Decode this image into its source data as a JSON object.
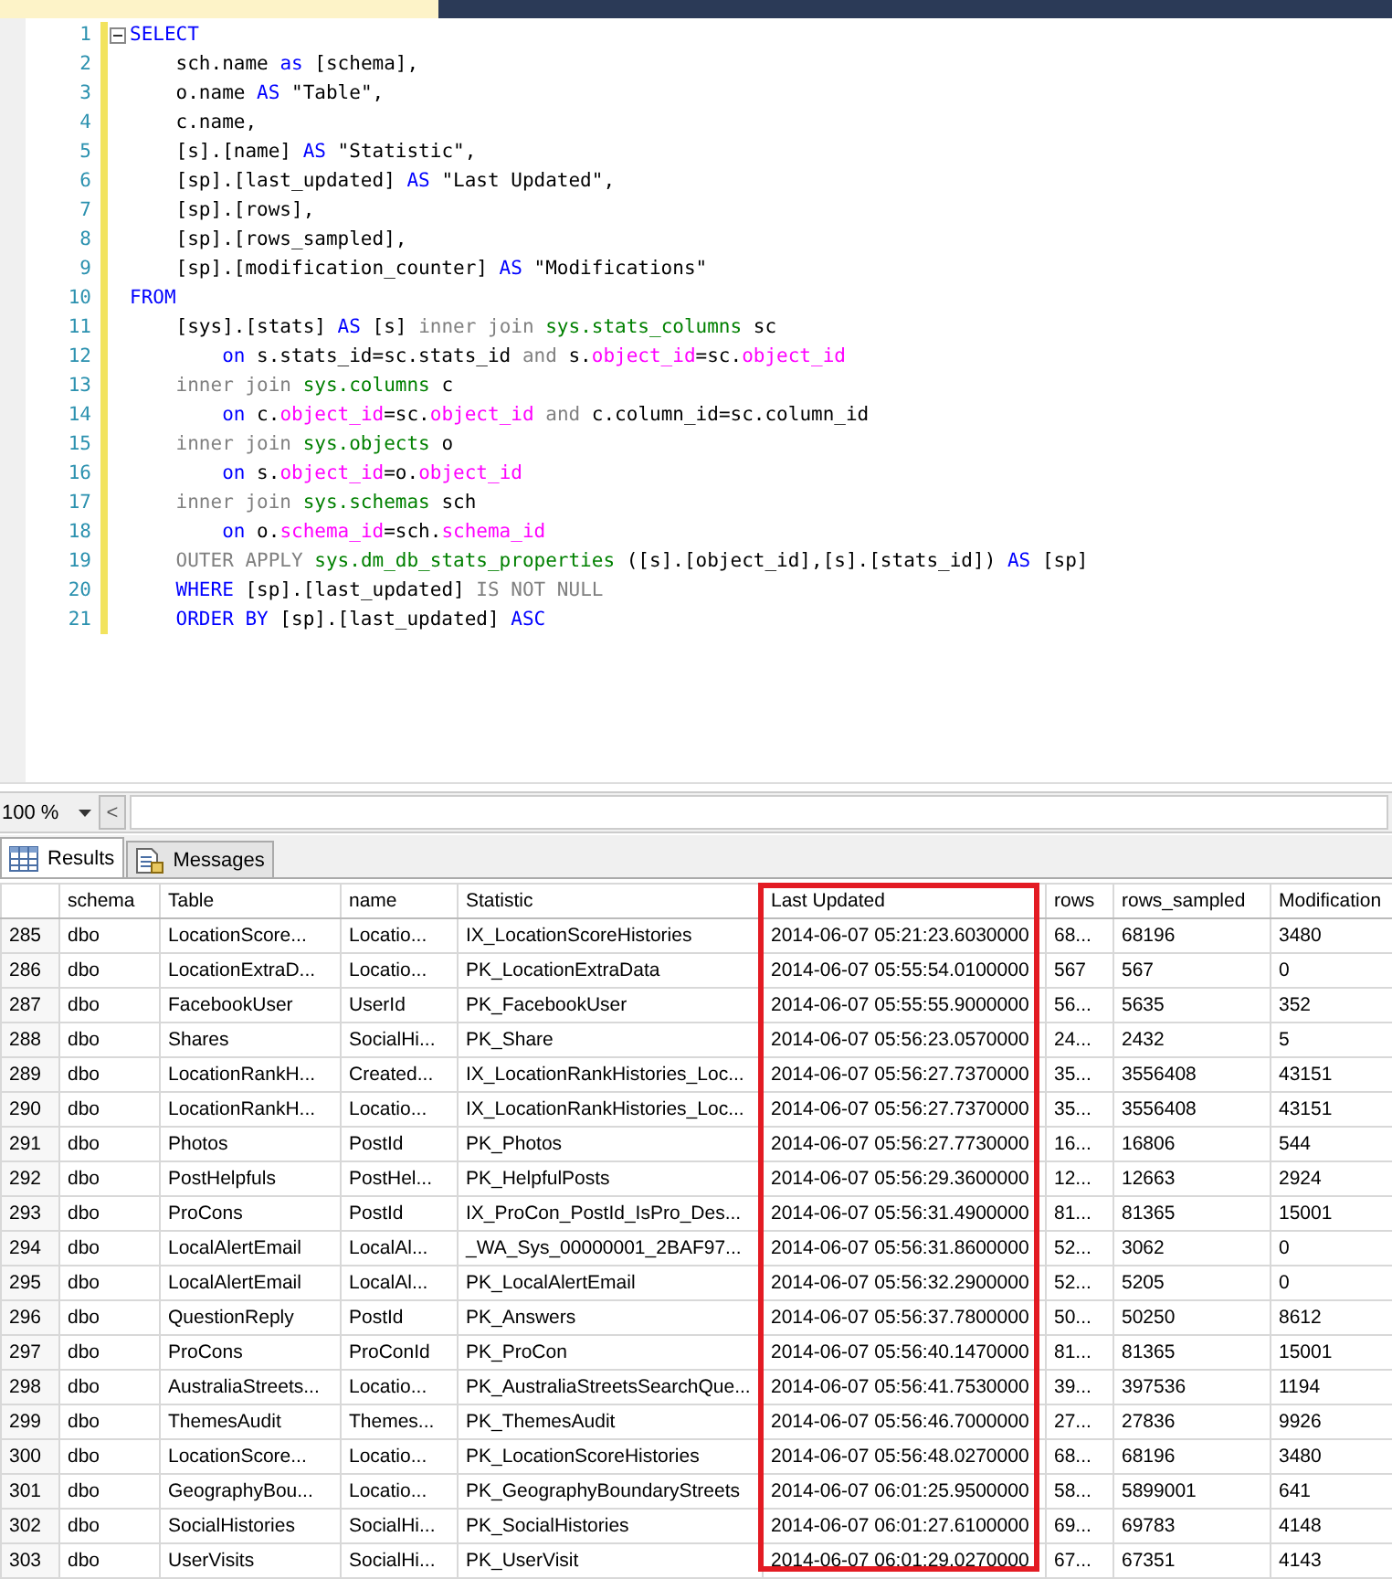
{
  "editor": {
    "lines": [
      {
        "number": "1",
        "tokens": [
          {
            "kind": "kw",
            "text": "SELECT"
          }
        ]
      },
      {
        "number": "2",
        "tokens": [
          {
            "kind": "plain",
            "text": "    sch.name "
          },
          {
            "kind": "kw",
            "text": "as"
          },
          {
            "kind": "plain",
            "text": " [schema],"
          }
        ]
      },
      {
        "number": "3",
        "tokens": [
          {
            "kind": "plain",
            "text": "    o.name "
          },
          {
            "kind": "kw",
            "text": "AS"
          },
          {
            "kind": "plain",
            "text": " \"Table\","
          }
        ]
      },
      {
        "number": "4",
        "tokens": [
          {
            "kind": "plain",
            "text": "    c.name,"
          }
        ]
      },
      {
        "number": "5",
        "tokens": [
          {
            "kind": "plain",
            "text": "    [s].[name] "
          },
          {
            "kind": "kw",
            "text": "AS"
          },
          {
            "kind": "plain",
            "text": " \"Statistic\","
          }
        ]
      },
      {
        "number": "6",
        "tokens": [
          {
            "kind": "plain",
            "text": "    [sp].[last_updated] "
          },
          {
            "kind": "kw",
            "text": "AS"
          },
          {
            "kind": "plain",
            "text": " \"Last Updated\","
          }
        ]
      },
      {
        "number": "7",
        "tokens": [
          {
            "kind": "plain",
            "text": "    [sp].[rows],"
          }
        ]
      },
      {
        "number": "8",
        "tokens": [
          {
            "kind": "plain",
            "text": "    [sp].[rows_sampled],"
          }
        ]
      },
      {
        "number": "9",
        "tokens": [
          {
            "kind": "plain",
            "text": "    [sp].[modification_counter] "
          },
          {
            "kind": "kw",
            "text": "AS"
          },
          {
            "kind": "plain",
            "text": " \"Modifications\""
          }
        ]
      },
      {
        "number": "10",
        "tokens": [
          {
            "kind": "kw",
            "text": "FROM"
          }
        ]
      },
      {
        "number": "11",
        "tokens": [
          {
            "kind": "plain",
            "text": "    [sys].[stats] "
          },
          {
            "kind": "kw",
            "text": "AS"
          },
          {
            "kind": "plain",
            "text": " [s] "
          },
          {
            "kind": "op",
            "text": "inner join "
          },
          {
            "kind": "sys",
            "text": "sys.stats_columns"
          },
          {
            "kind": "plain",
            "text": " sc"
          }
        ]
      },
      {
        "number": "12",
        "tokens": [
          {
            "kind": "kw",
            "text": "        on"
          },
          {
            "kind": "plain",
            "text": " s.stats_id=sc.stats_id "
          },
          {
            "kind": "op",
            "text": "and"
          },
          {
            "kind": "plain",
            "text": " s."
          },
          {
            "kind": "col",
            "text": "object_id"
          },
          {
            "kind": "plain",
            "text": "=sc."
          },
          {
            "kind": "col",
            "text": "object_id"
          }
        ]
      },
      {
        "number": "13",
        "tokens": [
          {
            "kind": "op",
            "text": "    inner join "
          },
          {
            "kind": "sys",
            "text": "sys.columns"
          },
          {
            "kind": "plain",
            "text": " c"
          }
        ]
      },
      {
        "number": "14",
        "tokens": [
          {
            "kind": "kw",
            "text": "        on"
          },
          {
            "kind": "plain",
            "text": " c."
          },
          {
            "kind": "col",
            "text": "object_id"
          },
          {
            "kind": "plain",
            "text": "=sc."
          },
          {
            "kind": "col",
            "text": "object_id"
          },
          {
            "kind": "op",
            "text": " and"
          },
          {
            "kind": "plain",
            "text": " c.column_id=sc.column_id"
          }
        ]
      },
      {
        "number": "15",
        "tokens": [
          {
            "kind": "op",
            "text": "    inner join "
          },
          {
            "kind": "sys",
            "text": "sys.objects"
          },
          {
            "kind": "plain",
            "text": " o"
          }
        ]
      },
      {
        "number": "16",
        "tokens": [
          {
            "kind": "kw",
            "text": "        on"
          },
          {
            "kind": "plain",
            "text": " s."
          },
          {
            "kind": "col",
            "text": "object_id"
          },
          {
            "kind": "plain",
            "text": "=o."
          },
          {
            "kind": "col",
            "text": "object_id"
          }
        ]
      },
      {
        "number": "17",
        "tokens": [
          {
            "kind": "op",
            "text": "    inner join "
          },
          {
            "kind": "sys",
            "text": "sys.schemas"
          },
          {
            "kind": "plain",
            "text": " sch"
          }
        ]
      },
      {
        "number": "18",
        "tokens": [
          {
            "kind": "kw",
            "text": "        on"
          },
          {
            "kind": "plain",
            "text": " o."
          },
          {
            "kind": "col",
            "text": "schema_id"
          },
          {
            "kind": "plain",
            "text": "=sch."
          },
          {
            "kind": "col",
            "text": "schema_id"
          }
        ]
      },
      {
        "number": "19",
        "tokens": [
          {
            "kind": "op",
            "text": "    OUTER APPLY "
          },
          {
            "kind": "sys",
            "text": "sys.dm_db_stats_properties"
          },
          {
            "kind": "plain",
            "text": " ([s].[object_id],[s].[stats_id]) "
          },
          {
            "kind": "kw",
            "text": "AS"
          },
          {
            "kind": "plain",
            "text": " [sp]"
          }
        ]
      },
      {
        "number": "20",
        "tokens": [
          {
            "kind": "kw",
            "text": "    WHERE"
          },
          {
            "kind": "plain",
            "text": " [sp].[last_updated] "
          },
          {
            "kind": "op",
            "text": "IS NOT NULL"
          }
        ]
      },
      {
        "number": "21",
        "tokens": [
          {
            "kind": "kw",
            "text": "    ORDER BY"
          },
          {
            "kind": "plain",
            "text": " [sp].[last_updated] "
          },
          {
            "kind": "kw",
            "text": "ASC"
          }
        ]
      }
    ]
  },
  "zoom": {
    "value": "100 %",
    "scroll_button": "<"
  },
  "result_tabs": [
    {
      "label": "Results",
      "selected": true
    },
    {
      "label": "Messages",
      "selected": false
    }
  ],
  "grid": {
    "columns": [
      {
        "label": "schema",
        "highlighted": false
      },
      {
        "label": "Table",
        "highlighted": false
      },
      {
        "label": "name",
        "highlighted": false
      },
      {
        "label": "Statistic",
        "highlighted": false
      },
      {
        "label": "Last Updated",
        "highlighted": true
      },
      {
        "label": "rows",
        "highlighted": false
      },
      {
        "label": "rows_sampled",
        "highlighted": false
      },
      {
        "label": "Modification",
        "highlighted": false
      }
    ],
    "rows": [
      {
        "number": "285",
        "cells": [
          "dbo",
          "LocationScore...",
          "Locatio...",
          "IX_LocationScoreHistories",
          "2014-06-07 05:21:23.6030000",
          "68...",
          "68196",
          "3480"
        ]
      },
      {
        "number": "286",
        "cells": [
          "dbo",
          "LocationExtraD...",
          "Locatio...",
          "PK_LocationExtraData",
          "2014-06-07 05:55:54.0100000",
          "567",
          "567",
          "0"
        ]
      },
      {
        "number": "287",
        "cells": [
          "dbo",
          "FacebookUser",
          "UserId",
          "PK_FacebookUser",
          "2014-06-07 05:55:55.9000000",
          "56...",
          "5635",
          "352"
        ]
      },
      {
        "number": "288",
        "cells": [
          "dbo",
          "Shares",
          "SocialHi...",
          "PK_Share",
          "2014-06-07 05:56:23.0570000",
          "24...",
          "2432",
          "5"
        ]
      },
      {
        "number": "289",
        "cells": [
          "dbo",
          "LocationRankH...",
          "Created...",
          "IX_LocationRankHistories_Loc...",
          "2014-06-07 05:56:27.7370000",
          "35...",
          "3556408",
          "43151"
        ]
      },
      {
        "number": "290",
        "cells": [
          "dbo",
          "LocationRankH...",
          "Locatio...",
          "IX_LocationRankHistories_Loc...",
          "2014-06-07 05:56:27.7370000",
          "35...",
          "3556408",
          "43151"
        ]
      },
      {
        "number": "291",
        "cells": [
          "dbo",
          "Photos",
          "PostId",
          "PK_Photos",
          "2014-06-07 05:56:27.7730000",
          "16...",
          "16806",
          "544"
        ]
      },
      {
        "number": "292",
        "cells": [
          "dbo",
          "PostHelpfuls",
          "PostHel...",
          "PK_HelpfulPosts",
          "2014-06-07 05:56:29.3600000",
          "12...",
          "12663",
          "2924"
        ]
      },
      {
        "number": "293",
        "cells": [
          "dbo",
          "ProCons",
          "PostId",
          "IX_ProCon_PostId_IsPro_Des...",
          "2014-06-07 05:56:31.4900000",
          "81...",
          "81365",
          "15001"
        ]
      },
      {
        "number": "294",
        "cells": [
          "dbo",
          "LocalAlertEmail",
          "LocalAl...",
          "_WA_Sys_00000001_2BAF97...",
          "2014-06-07 05:56:31.8600000",
          "52...",
          "3062",
          "0"
        ]
      },
      {
        "number": "295",
        "cells": [
          "dbo",
          "LocalAlertEmail",
          "LocalAl...",
          "PK_LocalAlertEmail",
          "2014-06-07 05:56:32.2900000",
          "52...",
          "5205",
          "0"
        ]
      },
      {
        "number": "296",
        "cells": [
          "dbo",
          "QuestionReply",
          "PostId",
          "PK_Answers",
          "2014-06-07 05:56:37.7800000",
          "50...",
          "50250",
          "8612"
        ]
      },
      {
        "number": "297",
        "cells": [
          "dbo",
          "ProCons",
          "ProConId",
          "PK_ProCon",
          "2014-06-07 05:56:40.1470000",
          "81...",
          "81365",
          "15001"
        ]
      },
      {
        "number": "298",
        "cells": [
          "dbo",
          "AustraliaStreets...",
          "Locatio...",
          "PK_AustraliaStreetsSearchQue...",
          "2014-06-07 05:56:41.7530000",
          "39...",
          "397536",
          "1194"
        ]
      },
      {
        "number": "299",
        "cells": [
          "dbo",
          "ThemesAudit",
          "Themes...",
          "PK_ThemesAudit",
          "2014-06-07 05:56:46.7000000",
          "27...",
          "27836",
          "9926"
        ]
      },
      {
        "number": "300",
        "cells": [
          "dbo",
          "LocationScore...",
          "Locatio...",
          "PK_LocationScoreHistories",
          "2014-06-07 05:56:48.0270000",
          "68...",
          "68196",
          "3480"
        ]
      },
      {
        "number": "301",
        "cells": [
          "dbo",
          "GeographyBou...",
          "Locatio...",
          "PK_GeographyBoundaryStreets",
          "2014-06-07 06:01:25.9500000",
          "58...",
          "5899001",
          "641"
        ]
      },
      {
        "number": "302",
        "cells": [
          "dbo",
          "SocialHistories",
          "SocialHi...",
          "PK_SocialHistories",
          "2014-06-07 06:01:27.6100000",
          "69...",
          "69783",
          "4148"
        ]
      },
      {
        "number": "303",
        "cells": [
          "dbo",
          "UserVisits",
          "SocialHi...",
          "PK_UserVisit",
          "2014-06-07 06:01:29.0270000",
          "67...",
          "67351",
          "4143"
        ]
      }
    ]
  }
}
